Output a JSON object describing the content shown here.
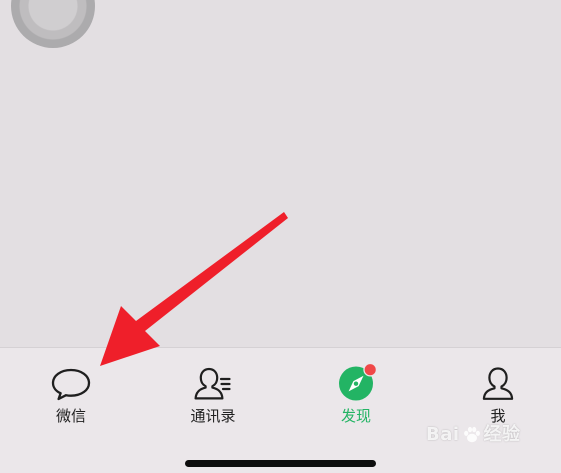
{
  "tabbar": {
    "items": [
      {
        "label": "微信",
        "icon": "chat-bubble-icon",
        "active": false
      },
      {
        "label": "通讯录",
        "icon": "contacts-icon",
        "active": false
      },
      {
        "label": "发现",
        "icon": "compass-icon",
        "active": true,
        "badge": "red-dot"
      },
      {
        "label": "我",
        "icon": "person-icon",
        "active": false
      }
    ]
  },
  "watermark": {
    "text_left": "Bai",
    "text_right": "经验"
  },
  "colors": {
    "background": "#e3dfe2",
    "tabbar_background": "#ebe7ea",
    "active": "#23b464",
    "badge": "#f04848",
    "annotation_arrow": "#ef1f2a"
  }
}
